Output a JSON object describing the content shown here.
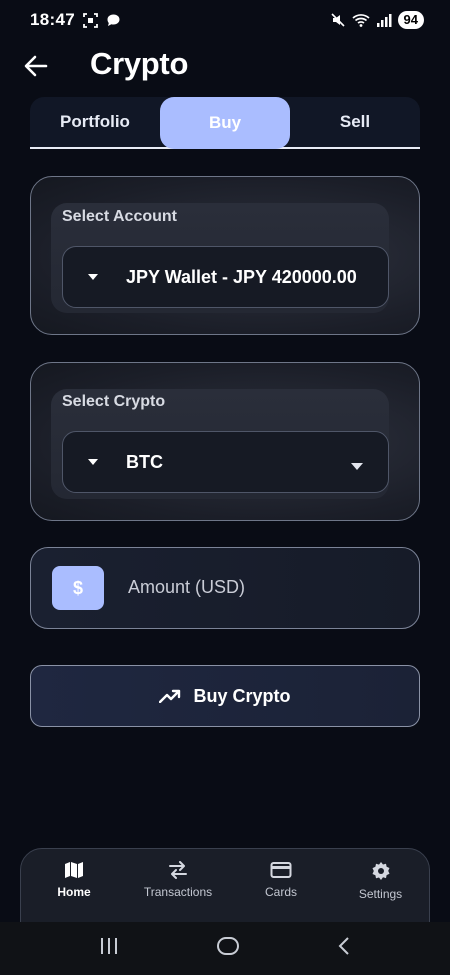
{
  "status_bar": {
    "time": "18:47",
    "battery": "94",
    "icons": [
      "screenshot-icon",
      "chat-bubble-icon",
      "mute-icon",
      "wifi-icon",
      "signal-icon"
    ]
  },
  "header": {
    "title": "Crypto",
    "back_icon": "arrow-left-icon"
  },
  "tabs": [
    {
      "label": "Portfolio",
      "active": false
    },
    {
      "label": "Buy",
      "active": true
    },
    {
      "label": "Sell",
      "active": false
    }
  ],
  "account_select": {
    "label": "Select Account",
    "value": "JPY Wallet - JPY 420000.00"
  },
  "crypto_select": {
    "label": "Select Crypto",
    "value": "BTC"
  },
  "amount": {
    "icon_text": "$",
    "placeholder": "Amount (USD)"
  },
  "buy_button": {
    "label": "Buy Crypto",
    "icon": "trending-up-icon"
  },
  "bottom_nav": [
    {
      "label": "Home",
      "icon": "map-icon",
      "active": true
    },
    {
      "label": "Transactions",
      "icon": "swap-arrows-icon",
      "active": false
    },
    {
      "label": "Cards",
      "icon": "credit-card-icon",
      "active": false
    },
    {
      "label": "Settings",
      "icon": "gear-icon",
      "active": false
    }
  ],
  "colors": {
    "background": "#090c15",
    "accent": "#aabdff",
    "card_border": "#6e7688"
  }
}
